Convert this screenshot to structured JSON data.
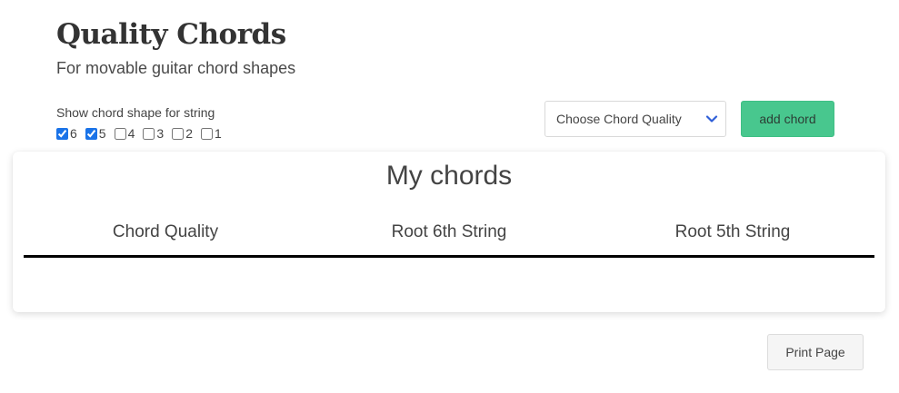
{
  "header": {
    "title": "Quality Chords",
    "subtitle": "For movable guitar chord shapes"
  },
  "strings": {
    "label": "Show chord shape for string",
    "options": [
      {
        "label": "6",
        "checked": true
      },
      {
        "label": "5",
        "checked": true
      },
      {
        "label": "4",
        "checked": false
      },
      {
        "label": "3",
        "checked": false
      },
      {
        "label": "2",
        "checked": false
      },
      {
        "label": "1",
        "checked": false
      }
    ]
  },
  "controls": {
    "select_value": "Choose Chord Quality",
    "add_label": "add chord",
    "add_color": "#48c78e"
  },
  "chords": {
    "title": "My chords",
    "columns": [
      "Chord Quality",
      "Root 6th String",
      "Root 5th String"
    ]
  },
  "footer": {
    "print_label": "Print Page"
  }
}
